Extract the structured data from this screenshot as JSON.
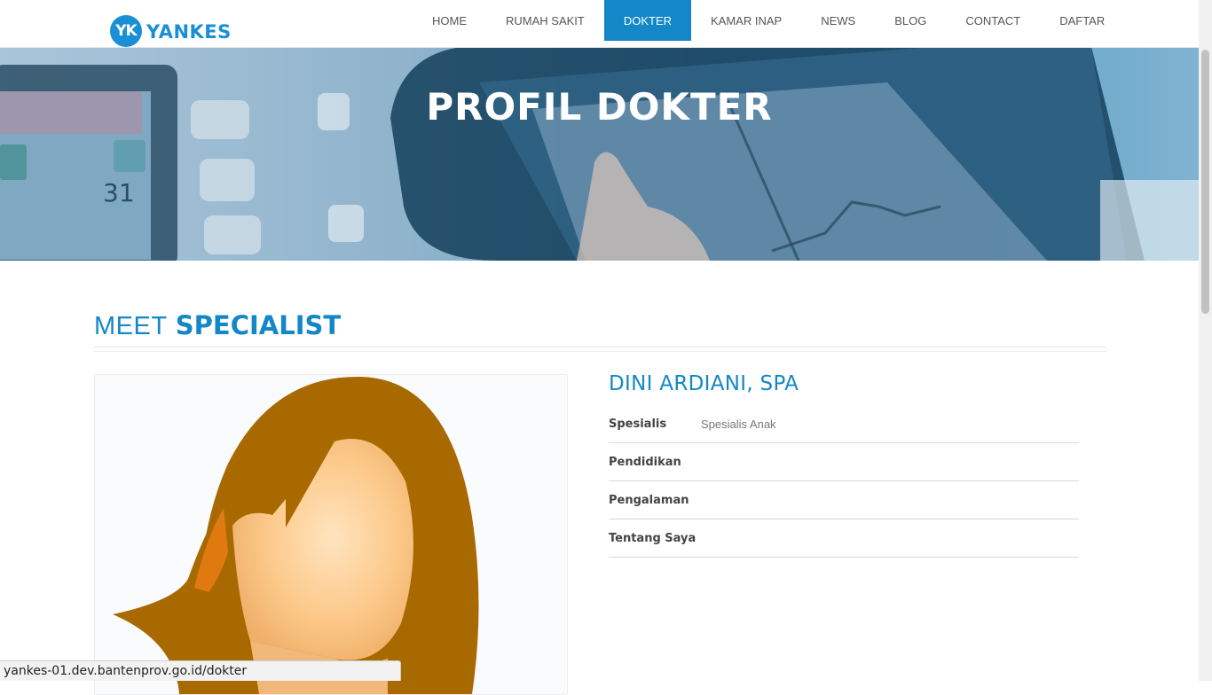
{
  "brand": {
    "logo_badge": "YK",
    "logo_text": "YANKES"
  },
  "nav": {
    "items": [
      {
        "label": "HOME"
      },
      {
        "label": "RUMAH SAKIT"
      },
      {
        "label": "DOKTER"
      },
      {
        "label": "KAMAR INAP"
      },
      {
        "label": "NEWS"
      },
      {
        "label": "BLOG"
      },
      {
        "label": "CONTACT"
      },
      {
        "label": "DAFTAR"
      }
    ],
    "active": "DOKTER"
  },
  "hero": {
    "title": "PROFIL DOKTER",
    "display_digits": "31"
  },
  "section": {
    "title_light": "MEET",
    "title_bold": "SPECIALIST"
  },
  "doctor": {
    "name": "DINI ARDIANI, SPA",
    "fields": [
      {
        "label": "Spesialis",
        "value": "Spesialis Anak"
      },
      {
        "label": "Pendidikan",
        "value": ""
      },
      {
        "label": "Pengalaman",
        "value": ""
      },
      {
        "label": "Tentang Saya",
        "value": ""
      }
    ]
  },
  "statusbar": {
    "url": "yankes-01.dev.bantenprov.go.id/dokter"
  },
  "colors": {
    "accent": "#1387c8",
    "hair": "#a86a00",
    "skin": "#fcc98a"
  }
}
